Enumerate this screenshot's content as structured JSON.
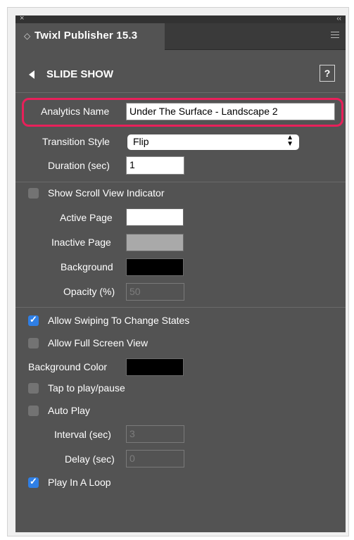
{
  "panel": {
    "close_glyph": "×",
    "collapse_glyph": "‹‹",
    "tab_title": "Twixl Publisher 15.3",
    "menu_icon": "hamburger-icon"
  },
  "header": {
    "title": "SLIDE SHOW",
    "help_label": "?"
  },
  "analytics": {
    "label": "Analytics Name",
    "value": "Under The Surface - Landscape 2"
  },
  "transition": {
    "label": "Transition Style",
    "value": "Flip"
  },
  "duration": {
    "label": "Duration (sec)",
    "value": "1"
  },
  "scroll_indicator": {
    "label": "Show Scroll View Indicator",
    "checked": false,
    "active_page_label": "Active Page",
    "active_page_color": "#ffffff",
    "inactive_page_label": "Inactive Page",
    "inactive_page_color": "#a9a9a9",
    "background_label": "Background",
    "background_color": "#000000",
    "opacity_label": "Opacity (%)",
    "opacity_placeholder": "50"
  },
  "options": {
    "allow_swiping": {
      "label": "Allow Swiping To Change States",
      "checked": true
    },
    "allow_fullscreen": {
      "label": "Allow Full Screen View",
      "checked": false
    },
    "background_color_label": "Background Color",
    "background_color": "#000000",
    "tap_to_play": {
      "label": "Tap to play/pause",
      "checked": false
    },
    "auto_play": {
      "label": "Auto Play",
      "checked": false
    },
    "interval_label": "Interval (sec)",
    "interval_placeholder": "3",
    "delay_label": "Delay (sec)",
    "delay_placeholder": "0",
    "play_in_loop": {
      "label": "Play In A Loop",
      "checked": true
    }
  },
  "colors": {
    "accent": "#2f7fe5",
    "highlight": "#e8205a",
    "panel_bg": "#535353"
  }
}
